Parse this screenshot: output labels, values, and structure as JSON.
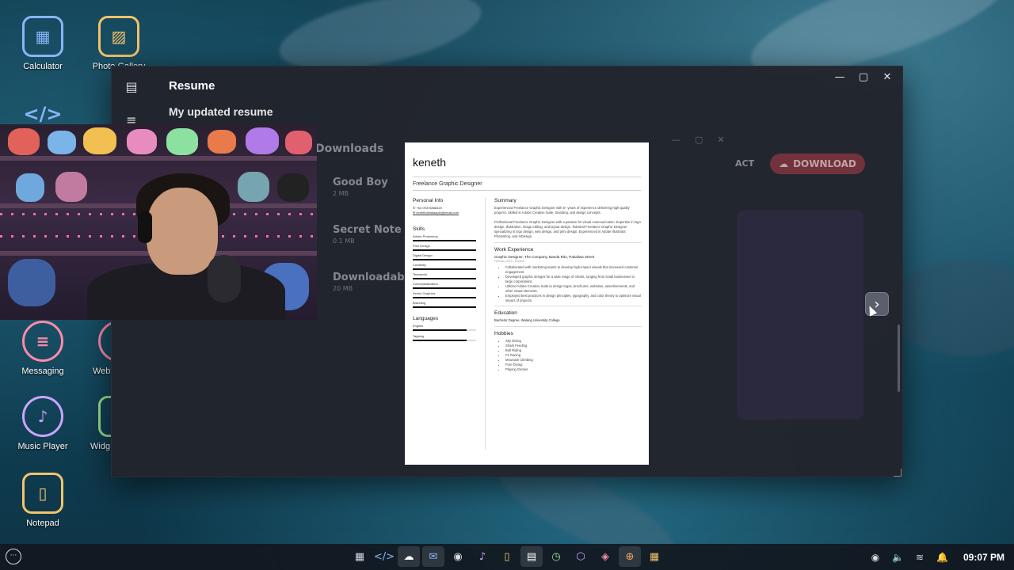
{
  "desktop": {
    "icons": [
      {
        "label": "Calculator",
        "icon": "calculator-icon",
        "color": "#8ab4f8"
      },
      {
        "label": "Photo Gallery",
        "icon": "photo-gallery-icon",
        "color": "#f4c36b"
      },
      {
        "label": "Messaging",
        "icon": "messaging-icon",
        "color": "#ff8aa8"
      },
      {
        "label": "Web",
        "icon": "web-icon",
        "color": "#ff8aa8"
      },
      {
        "label": "Music Player",
        "icon": "music-player-icon",
        "color": "#c9a4ff"
      },
      {
        "label": "Widg",
        "icon": "widgets-icon",
        "color": "#9fe08b"
      },
      {
        "label": "Notepad",
        "icon": "notepad-icon",
        "color": "#f4c36b"
      }
    ],
    "code_icon_glyph": "</>"
  },
  "window": {
    "title": "Resume",
    "subtitle": "My updated resume",
    "controls": {
      "minimize": "—",
      "maximize": "▢",
      "close": "✕"
    }
  },
  "background_app": {
    "section_title": "Downloads",
    "items": [
      {
        "name": "Good Boy",
        "size": "2 MB"
      },
      {
        "name": "Secret Note",
        "size": "0.1 MB"
      },
      {
        "name": "Downloadable",
        "size": "20 MB"
      }
    ],
    "contact_label": "ACT",
    "download_label": "DOWNLOAD"
  },
  "resume": {
    "name": "keneth",
    "role": "Freelance Graphic Designer",
    "personal_info_heading": "Personal Info",
    "phone": "+63 09376868420",
    "email": "kenethdimalaapin@email.com",
    "skills_heading": "Skills",
    "skills": [
      "Adobe Photoshop",
      "Print Design",
      "Digital Design",
      "Creativity",
      "Teamwork",
      "Conceptualization",
      "Vector Graphics",
      "Branding"
    ],
    "languages_heading": "Languages",
    "languages": [
      {
        "name": "English",
        "level": 0.85
      },
      {
        "name": "Tagalog",
        "level": 0.85
      }
    ],
    "summary_heading": "Summary",
    "summary_p1": "Experienced Freelance Graphic Designer with 5+ years of experience delivering high-quality projects. Skilled in Adobe Creative Suite, branding, and design concepts.",
    "summary_p2": "Professional Freelance Graphic Designer with a passion for visual communication. Expertise in logo design, illustration, image editing, and layout design. Talented Freelance Graphic Designer specializing in logo design, web design, and print design. Experienced in Adobe Illustrator, Photoshop, and InDesign.",
    "experience_heading": "Work Experience",
    "job_title": "Graphic Designer, The Company, Banda Rito, Pakaliwa Street",
    "job_dates": "February 2015 - Present",
    "job_bullets": [
      "Collaborated with marketing teams to develop high-impact visuals that increased customer engagement.",
      "Developed graphic designs for a wide range of clients, ranging from small businesses to large corporations.",
      "Utilized Adobe Creative Suite to design logos, brochures, websites, advertisements, and other visual elements.",
      "Employed best practices in design principles, typography, and color theory to optimize visual impact of projects."
    ],
    "education_heading": "Education",
    "education": "Bachelor Degree, Walang University College",
    "hobbies_heading": "Hobbies",
    "hobbies": [
      "Sky Diving",
      "Shark Feeding",
      "Bull Riding",
      "F1 Racing",
      "Mountain Climbing",
      "Free Diving",
      "Playing Games"
    ]
  },
  "viewer": {
    "next_glyph": "›"
  },
  "taskbar": {
    "start_glyph": "···",
    "apps": [
      {
        "icon": "calculator-icon",
        "glyph": "▦",
        "color": "#cfd6e6",
        "active": false
      },
      {
        "icon": "code-icon",
        "glyph": "</>",
        "color": "#8ab4f8",
        "active": false
      },
      {
        "icon": "cloud-download-icon",
        "glyph": "☁",
        "color": "#ffffff",
        "active": true
      },
      {
        "icon": "mail-icon",
        "glyph": "✉",
        "color": "#8ab4f8",
        "active": true
      },
      {
        "icon": "chat-icon",
        "glyph": "◉",
        "color": "#dddddd",
        "active": false
      },
      {
        "icon": "music-icon",
        "glyph": "♪",
        "color": "#c9a4ff",
        "active": false
      },
      {
        "icon": "notepad-icon",
        "glyph": "▯",
        "color": "#f4c36b",
        "active": false
      },
      {
        "icon": "resume-icon",
        "glyph": "▤",
        "color": "#ffffff",
        "active": true
      },
      {
        "icon": "clock-icon",
        "glyph": "◷",
        "color": "#9fe08b",
        "active": false
      },
      {
        "icon": "settings-icon",
        "glyph": "⬡",
        "color": "#c9a4ff",
        "active": false
      },
      {
        "icon": "game-icon",
        "glyph": "◈",
        "color": "#ff8aa8",
        "active": false
      },
      {
        "icon": "globe-icon",
        "glyph": "⊕",
        "color": "#f4a35b",
        "active": true
      },
      {
        "icon": "apps-grid-icon",
        "glyph": "▦",
        "color": "#f4c36b",
        "active": false
      }
    ],
    "tray": {
      "record_glyph": "◉",
      "volume_glyph": "🔈",
      "wifi_glyph": "≋",
      "bell_glyph": "🔔",
      "time": "09:07 PM"
    }
  }
}
